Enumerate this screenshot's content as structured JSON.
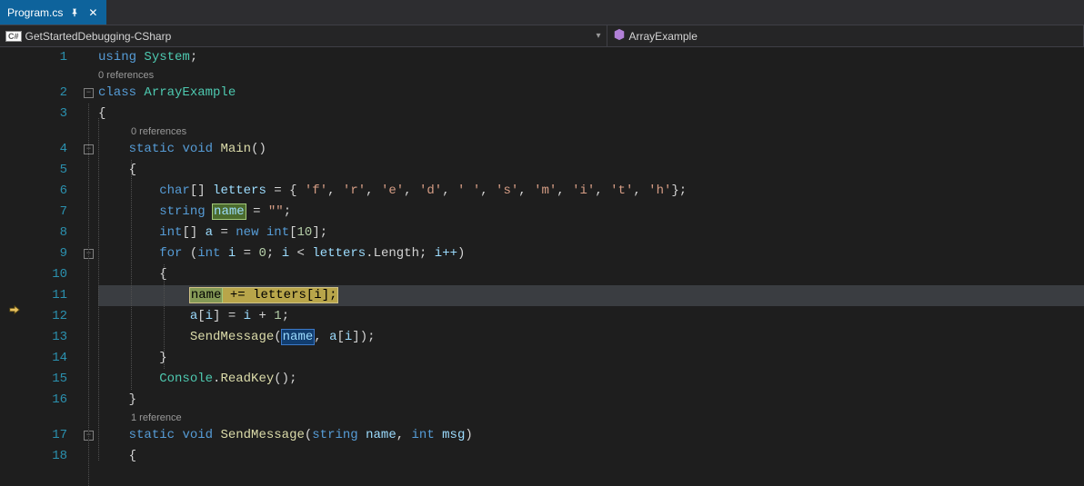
{
  "tab": {
    "title": "Program.cs"
  },
  "nav": {
    "left": "GetStartedDebugging-CSharp",
    "right": "ArrayExample"
  },
  "executionLine": 11,
  "codelens": {
    "class": "0 references",
    "main": "0 references",
    "sendmessage": "1 reference"
  },
  "code": {
    "l1": {
      "using": "using",
      "system": "System",
      "semi": ";"
    },
    "l2": {
      "class": "class",
      "name": "ArrayExample"
    },
    "l3": {
      "brace": "{"
    },
    "l4": {
      "static": "static",
      "void": "void",
      "main": "Main",
      "parens": "()"
    },
    "l5": {
      "brace": "{"
    },
    "l6": {
      "char": "char",
      "brackets": "[]",
      "letters": "letters",
      "eq": "=",
      "open": "{",
      "f": "'f'",
      "r": "'r'",
      "e": "'e'",
      "d": "'d'",
      "sp": "' '",
      "s": "'s'",
      "m": "'m'",
      "i": "'i'",
      "t": "'t'",
      "h": "'h'",
      "close": "}",
      "semi": ";"
    },
    "l7": {
      "string": "string",
      "name": "name",
      "eq": "=",
      "empty": "\"\"",
      "semi": ";"
    },
    "l8": {
      "int": "int",
      "br": "[]",
      "a": "a",
      "eq": "=",
      "new": "new",
      "int2": "int",
      "ten": "10",
      "semi": ";"
    },
    "l9": {
      "for": "for",
      "int": "int",
      "i": "i",
      "zero": "0",
      "lt": "<",
      "letters": "letters",
      "length": "Length",
      "ipp": "i++",
      "semi": ";"
    },
    "l10": {
      "brace": "{"
    },
    "l11": {
      "name": "name",
      "pluseq": "+=",
      "letters": "letters",
      "lb": "[",
      "i": "i",
      "rb": "]",
      "semi": ";"
    },
    "l12": {
      "a": "a",
      "lb": "[",
      "i": "i",
      "rb": "]",
      "eq": "=",
      "i2": "i",
      "plus": "+",
      "one": "1",
      "semi": ";"
    },
    "l13": {
      "send": "SendMessage",
      "lp": "(",
      "name": "name",
      "comma": ",",
      "a": "a",
      "lb": "[",
      "i": "i",
      "rb": "]",
      "rp": ")",
      "semi": ";"
    },
    "l14": {
      "brace": "}"
    },
    "l15": {
      "console": "Console",
      "dot": ".",
      "readkey": "ReadKey",
      "parens": "()",
      "semi": ";"
    },
    "l16": {
      "brace": "}"
    },
    "l17": {
      "static": "static",
      "void": "void",
      "send": "SendMessage",
      "lp": "(",
      "string": "string",
      "name": "name",
      "comma": ",",
      "int": "int",
      "msg": "msg",
      "rp": ")"
    },
    "l18": {
      "brace": "{"
    }
  },
  "lineNumbers": [
    "1",
    "2",
    "3",
    "4",
    "5",
    "6",
    "7",
    "8",
    "9",
    "10",
    "11",
    "12",
    "13",
    "14",
    "15",
    "16",
    "17",
    "18"
  ]
}
